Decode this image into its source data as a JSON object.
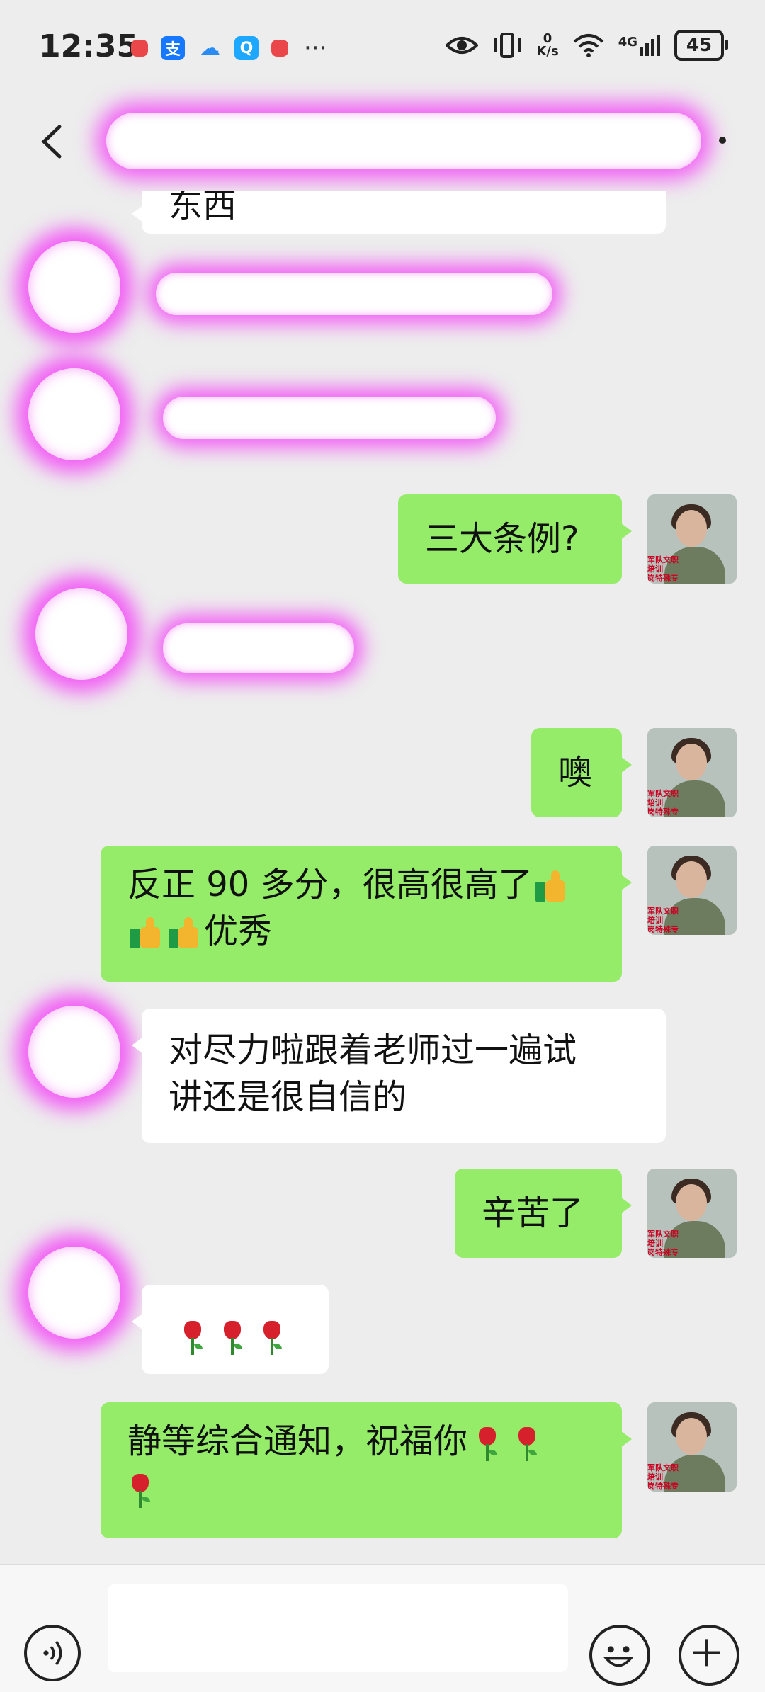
{
  "status_bar": {
    "time": "12:35",
    "network_speed_value": "0",
    "network_speed_unit": "K/s",
    "signal_type": "4G",
    "battery": "45"
  },
  "header": {
    "back_icon": "chevron-left-icon",
    "more_icon": "more-icon"
  },
  "messages": [
    {
      "side": "in",
      "text": "东西",
      "redacted_avatar": true
    },
    {
      "side": "in",
      "text": "",
      "redacted": true
    },
    {
      "side": "in",
      "text": "",
      "redacted": true
    },
    {
      "side": "out",
      "text": "三大条例?"
    },
    {
      "side": "in",
      "text": "",
      "redacted": true
    },
    {
      "side": "out",
      "text": "噢"
    },
    {
      "side": "out",
      "text_line1": "反正 90 多分，很高很高了",
      "text_line2": "优秀"
    },
    {
      "side": "in",
      "text_line1": "对尽力啦跟着老师过一遍试",
      "text_line2": "讲还是很自信的"
    },
    {
      "side": "out",
      "text": "辛苦了"
    },
    {
      "side": "in",
      "text": "",
      "emoji": "rose x3"
    },
    {
      "side": "out",
      "text": "静等综合通知，祝福你"
    }
  ],
  "avatar": {
    "tag_line1": "军队文职培训",
    "tag_line2": "岗特殊专家"
  },
  "bottom_bar": {
    "voice_icon": "voice-icon",
    "emoji_icon": "emoji-icon",
    "plus_icon": "plus-icon",
    "input_placeholder": ""
  },
  "colors": {
    "background": "#ededed",
    "outgoing_bubble": "#95ec69",
    "incoming_bubble": "#ffffff",
    "redaction": "#f25ef5"
  }
}
